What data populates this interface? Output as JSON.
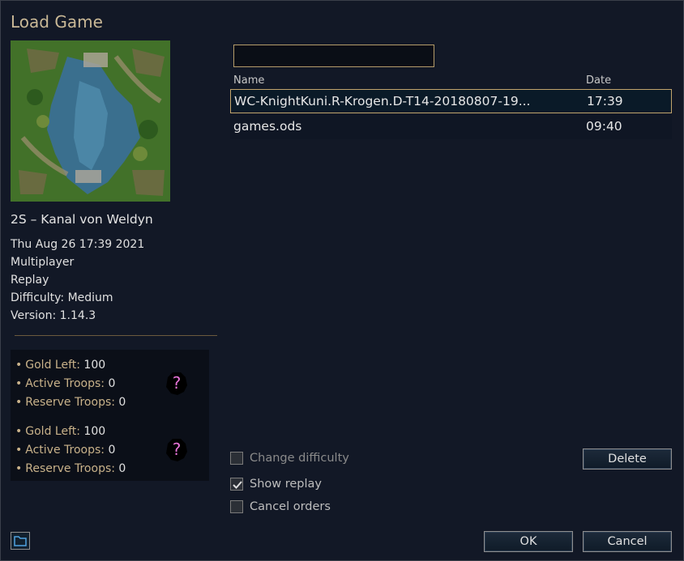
{
  "dialog": {
    "title": "Load Game"
  },
  "preview": {
    "scenario_name": "2S – Kanal von Weldyn",
    "details": [
      "Thu Aug 26 17:39 2021",
      "Multiplayer",
      "Replay",
      "Difficulty: Medium",
      "Version: 1.14.3"
    ]
  },
  "sides": [
    {
      "gold_label": "Gold Left:",
      "gold": "100",
      "active_label": "Active Troops:",
      "active": "0",
      "reserve_label": "Reserve Troops:",
      "reserve": "0",
      "leader_icon": "unknown-leader-icon"
    },
    {
      "gold_label": "Gold Left:",
      "gold": "100",
      "active_label": "Active Troops:",
      "active": "0",
      "reserve_label": "Reserve Troops:",
      "reserve": "0",
      "leader_icon": "unknown-leader-icon"
    }
  ],
  "filter": {
    "value": ""
  },
  "list": {
    "headers": {
      "name": "Name",
      "date": "Date"
    },
    "rows": [
      {
        "name": "WC-KnightKuni.R-Krogen.D-T14-20180807-19...",
        "date": "17:39",
        "selected": true
      },
      {
        "name": "games.ods",
        "date": "09:40",
        "selected": false
      }
    ]
  },
  "options": {
    "change_difficulty": {
      "label": "Change difficulty",
      "checked": false,
      "enabled": false
    },
    "show_replay": {
      "label": "Show replay",
      "checked": true,
      "enabled": true
    },
    "cancel_orders": {
      "label": "Cancel orders",
      "checked": false,
      "enabled": true
    }
  },
  "buttons": {
    "delete": "Delete",
    "ok": "OK",
    "cancel": "Cancel"
  },
  "colors": {
    "accent": "#c9b896",
    "selection_border": "#c2a46c",
    "question": "#e673d6"
  }
}
